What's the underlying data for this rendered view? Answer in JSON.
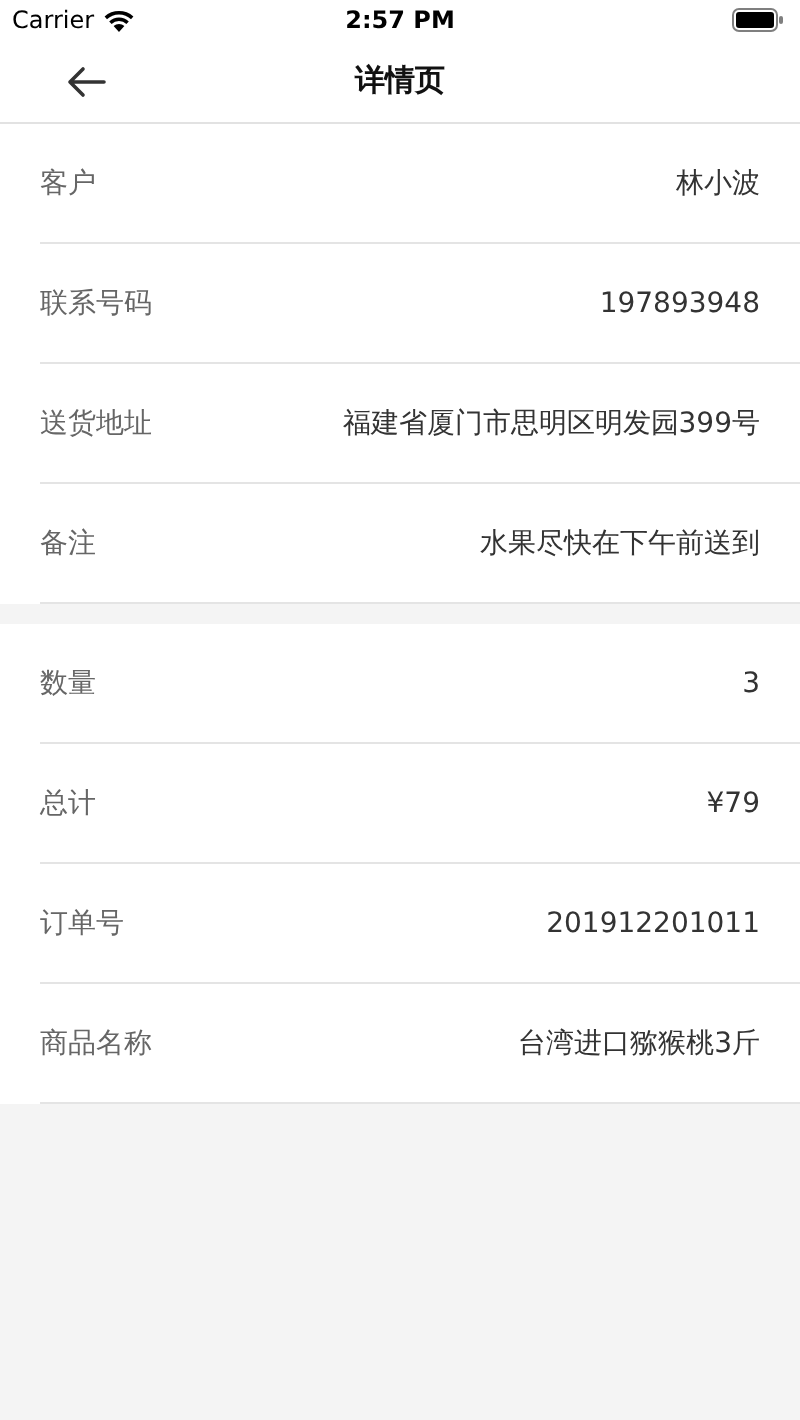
{
  "status_bar": {
    "carrier": "Carrier",
    "time": "2:57 PM"
  },
  "nav": {
    "title": "详情页"
  },
  "sections": [
    {
      "rows": [
        {
          "label": "客户",
          "value": "林小波"
        },
        {
          "label": "联系号码",
          "value": "197893948"
        },
        {
          "label": "送货地址",
          "value": "福建省厦门市思明区明发园399号"
        },
        {
          "label": "备注",
          "value": "水果尽快在下午前送到"
        }
      ]
    },
    {
      "rows": [
        {
          "label": "数量",
          "value": "3"
        },
        {
          "label": "总计",
          "value": "¥79"
        },
        {
          "label": "订单号",
          "value": "201912201011"
        },
        {
          "label": "商品名称",
          "value": "台湾进口猕猴桃3斤"
        }
      ]
    }
  ]
}
